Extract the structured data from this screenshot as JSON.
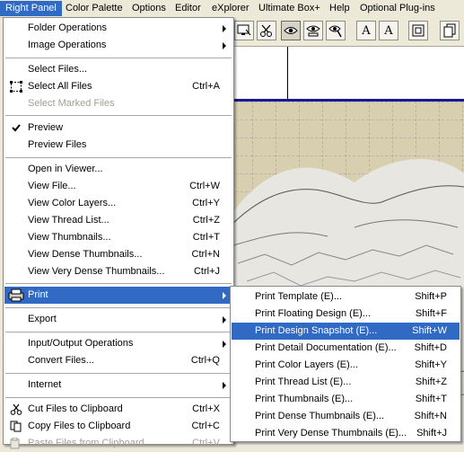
{
  "menubar": {
    "items": [
      "Right Panel",
      "Color Palette",
      "Options",
      "Editor",
      "eXplorer",
      "Ultimate Box+",
      "Help",
      "Optional Plug-ins"
    ]
  },
  "main_menu": {
    "items": [
      {
        "label": "Folder Operations",
        "shortcut": "",
        "submenu": true
      },
      {
        "label": "Image Operations",
        "shortcut": "",
        "submenu": true
      },
      {
        "label": "Select Files...",
        "shortcut": ""
      },
      {
        "label": "Select All Files",
        "shortcut": "Ctrl+A"
      },
      {
        "label": "Select Marked Files",
        "shortcut": "",
        "disabled": true
      },
      {
        "label": "Preview",
        "shortcut": "",
        "checked": true
      },
      {
        "label": "Preview Files",
        "shortcut": ""
      },
      {
        "label": "Open in Viewer...",
        "shortcut": ""
      },
      {
        "label": "View File...",
        "shortcut": "Ctrl+W"
      },
      {
        "label": "View Color Layers...",
        "shortcut": "Ctrl+Y"
      },
      {
        "label": "View Thread List...",
        "shortcut": "Ctrl+Z"
      },
      {
        "label": "View Thumbnails...",
        "shortcut": "Ctrl+T"
      },
      {
        "label": "View Dense Thumbnails...",
        "shortcut": "Ctrl+N"
      },
      {
        "label": "View Very Dense Thumbnails...",
        "shortcut": "Ctrl+J"
      },
      {
        "label": "Print",
        "shortcut": "",
        "submenu": true
      },
      {
        "label": "Export",
        "shortcut": "",
        "submenu": true
      },
      {
        "label": "Input/Output Operations",
        "shortcut": "",
        "submenu": true
      },
      {
        "label": "Convert Files...",
        "shortcut": "Ctrl+Q"
      },
      {
        "label": "Internet",
        "shortcut": "",
        "submenu": true
      },
      {
        "label": "Cut Files to Clipboard",
        "shortcut": "Ctrl+X"
      },
      {
        "label": "Copy Files to Clipboard",
        "shortcut": "Ctrl+C"
      },
      {
        "label": "Paste Files from Clipboard",
        "shortcut": "Ctrl+V",
        "disabled": true
      }
    ]
  },
  "print_submenu": {
    "items": [
      {
        "label": "Print Template (E)...",
        "shortcut": "Shift+P"
      },
      {
        "label": "Print Floating Design (E)...",
        "shortcut": "Shift+F"
      },
      {
        "label": "Print Design Snapshot (E)...",
        "shortcut": "Shift+W"
      },
      {
        "label": "Print Detail Documentation (E)...",
        "shortcut": "Shift+D"
      },
      {
        "label": "Print Color Layers (E)...",
        "shortcut": "Shift+Y"
      },
      {
        "label": "Print Thread List (E)...",
        "shortcut": "Shift+Z"
      },
      {
        "label": "Print Thumbnails (E)...",
        "shortcut": "Shift+T"
      },
      {
        "label": "Print Dense Thumbnails (E)...",
        "shortcut": "Shift+N"
      },
      {
        "label": "Print Very Dense Thumbnails (E)...",
        "shortcut": "Shift+J"
      }
    ]
  },
  "toolbar": {
    "text_tool_label": "A",
    "text_tool2_label": "A"
  },
  "colors": {
    "highlight": "#316ac5",
    "menu_bg": "#ffffff",
    "chrome": "#ece9d8",
    "design_bg": "#d8cfb0"
  }
}
